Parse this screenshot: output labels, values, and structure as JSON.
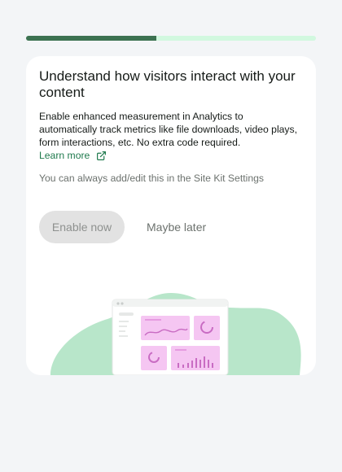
{
  "progress": {
    "fraction": 0.45
  },
  "card": {
    "title": "Understand how visitors interact with your content",
    "description": "Enable enhanced measurement in Analytics to automatically track metrics like file downloads, video plays, form interactions, etc. No extra code required.",
    "learn_more_label": "Learn more",
    "hint": "You can always add/edit this in the Site Kit Settings",
    "enable_label": "Enable now",
    "later_label": "Maybe later"
  },
  "colors": {
    "progress_fill": "#3c7251",
    "progress_track": "#d1f8df",
    "link": "#1f7a4d",
    "blob": "#b8e6ca",
    "widget_pink": "#f5c6f2"
  },
  "icons": {
    "external_link": "external-link-icon"
  }
}
